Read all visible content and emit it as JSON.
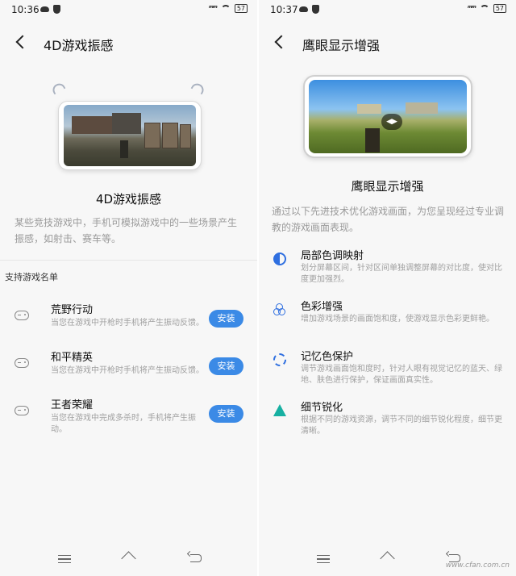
{
  "left_screen": {
    "status": {
      "time": "10:36",
      "signal": "ᵐᵐ",
      "battery": "57"
    },
    "header": {
      "title": "4D游戏振感"
    },
    "feature_title": "4D游戏振感",
    "description": "某些竞技游戏中，手机可模拟游戏中的一些场景产生振感，如射击、赛车等。",
    "section_label": "支持游戏名单",
    "games": [
      {
        "name": "荒野行动",
        "desc": "当您在游戏中开枪时手机将产生振动反馈。",
        "button": "安装"
      },
      {
        "name": "和平精英",
        "desc": "当您在游戏中开枪时手机将产生振动反馈。",
        "button": "安装"
      },
      {
        "name": "王者荣耀",
        "desc": "当您在游戏中完成多杀时，手机将产生振动。",
        "button": "安装"
      }
    ]
  },
  "right_screen": {
    "status": {
      "time": "10:37",
      "signal": "ᵐᵐ",
      "battery": "57"
    },
    "header": {
      "title": "鹰眼显示增强"
    },
    "feature_title": "鹰眼显示增强",
    "description": "通过以下先进技术优化游戏画面，为您呈现经过专业调教的游戏画面表现。",
    "features": [
      {
        "name": "局部色调映射",
        "desc": "划分屏幕区间，针对区间单独调整屏幕的对比度，使对比度更加强烈。",
        "icon": "half-circle-icon"
      },
      {
        "name": "色彩增强",
        "desc": "增加游戏场景的画面饱和度，使游戏显示色彩更鲜艳。",
        "icon": "color-circles-icon"
      },
      {
        "name": "记忆色保护",
        "desc": "调节游戏画面饱和度时，针对人眼有视觉记忆的蓝天、绿地、肤色进行保护，保证画面真实性。",
        "icon": "dropper-icon"
      },
      {
        "name": "细节锐化",
        "desc": "根据不同的游戏资源，调节不同的细节锐化程度，细节更清晰。",
        "icon": "triangle-icon"
      }
    ]
  },
  "watermark": "www.cfan.com.cn",
  "colors": {
    "accent": "#3b8ae6",
    "icon_blue": "#2f6fe0",
    "icon_teal": "#17b0a2"
  }
}
